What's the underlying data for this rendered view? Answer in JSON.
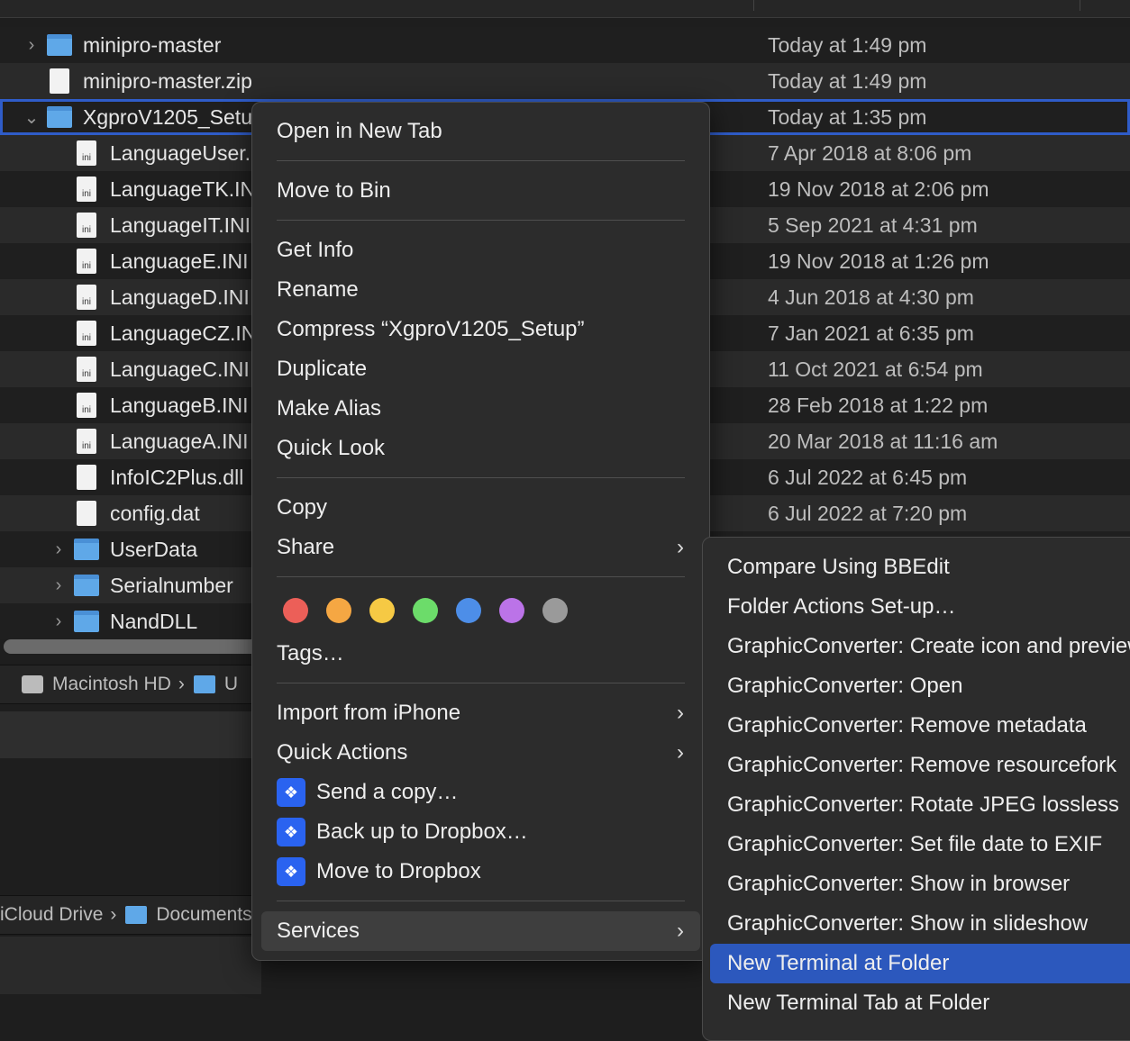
{
  "files": [
    {
      "name": "minipro-master",
      "date": "Today at 1:49 pm",
      "type": "folder",
      "level": 0,
      "disclosure": "collapsed"
    },
    {
      "name": "minipro-master.zip",
      "date": "Today at 1:49 pm",
      "type": "zip",
      "level": 0
    },
    {
      "name": "XgproV1205_Setup",
      "date": "Today at 1:35 pm",
      "type": "folder",
      "level": 0,
      "disclosure": "expanded",
      "selected": true
    },
    {
      "name": "LanguageUser.INI",
      "date": "7 Apr 2018 at 8:06 pm",
      "type": "ini",
      "level": 1
    },
    {
      "name": "LanguageTK.INI",
      "date": "19 Nov 2018 at 2:06 pm",
      "type": "ini",
      "level": 1
    },
    {
      "name": "LanguageIT.INI",
      "date": "5 Sep 2021 at 4:31 pm",
      "type": "ini",
      "level": 1
    },
    {
      "name": "LanguageE.INI",
      "date": "19 Nov 2018 at 1:26 pm",
      "type": "ini",
      "level": 1
    },
    {
      "name": "LanguageD.INI",
      "date": "4 Jun 2018 at 4:30 pm",
      "type": "ini",
      "level": 1
    },
    {
      "name": "LanguageCZ.INI",
      "date": "7 Jan 2021 at 6:35 pm",
      "type": "ini",
      "level": 1
    },
    {
      "name": "LanguageC.INI",
      "date": "11 Oct 2021 at 6:54 pm",
      "type": "ini",
      "level": 1
    },
    {
      "name": "LanguageB.INI",
      "date": "28 Feb 2018 at 1:22 pm",
      "type": "ini",
      "level": 1
    },
    {
      "name": "LanguageA.INI",
      "date": "20 Mar 2018 at 11:16 am",
      "type": "ini",
      "level": 1
    },
    {
      "name": "InfoIC2Plus.dll",
      "date": "6 Jul 2022 at 6:45 pm",
      "type": "dll",
      "level": 1
    },
    {
      "name": "config.dat",
      "date": "6 Jul 2022 at 7:20 pm",
      "type": "dat",
      "level": 1
    },
    {
      "name": "UserData",
      "date": "",
      "type": "folder",
      "level": 1,
      "disclosure": "collapsed"
    },
    {
      "name": "Serialnumber",
      "date": "",
      "type": "folder",
      "level": 1,
      "disclosure": "collapsed"
    },
    {
      "name": "NandDLL",
      "date": "",
      "type": "folder",
      "level": 1,
      "disclosure": "collapsed"
    }
  ],
  "pathbar1": {
    "drive": "Macintosh HD",
    "next": "U"
  },
  "pathbar2": {
    "root": "iCloud Drive",
    "next": "Documents"
  },
  "context_menu": {
    "open_new_tab": "Open in New Tab",
    "move_to_bin": "Move to Bin",
    "get_info": "Get Info",
    "rename": "Rename",
    "compress": "Compress “XgproV1205_Setup”",
    "duplicate": "Duplicate",
    "make_alias": "Make Alias",
    "quick_look": "Quick Look",
    "copy": "Copy",
    "share": "Share",
    "tag_colors": [
      "#ec5f58",
      "#f5a743",
      "#f6c944",
      "#6cdc6a",
      "#4d8ee8",
      "#bb73e8",
      "#9a9a9a"
    ],
    "tags": "Tags…",
    "import_iphone": "Import from iPhone",
    "quick_actions": "Quick Actions",
    "send_copy": "Send a copy…",
    "backup_dropbox": "Back up to Dropbox…",
    "move_dropbox": "Move to Dropbox",
    "services": "Services"
  },
  "services_menu": [
    "Compare Using BBEdit",
    "Folder Actions Set-up…",
    "GraphicConverter: Create icon and preview",
    "GraphicConverter: Open",
    "GraphicConverter: Remove metadata",
    "GraphicConverter: Remove resourcefork",
    "GraphicConverter: Rotate JPEG lossless",
    "GraphicConverter: Set file date to EXIF",
    "GraphicConverter: Show in browser",
    "GraphicConverter: Show in slideshow",
    "New Terminal at Folder",
    "New Terminal Tab at Folder"
  ],
  "services_active": "New Terminal at Folder",
  "colors": {
    "selection": "#2c58bd",
    "menu_bg": "#2c2c2c",
    "dropbox": "#2a63f0"
  }
}
